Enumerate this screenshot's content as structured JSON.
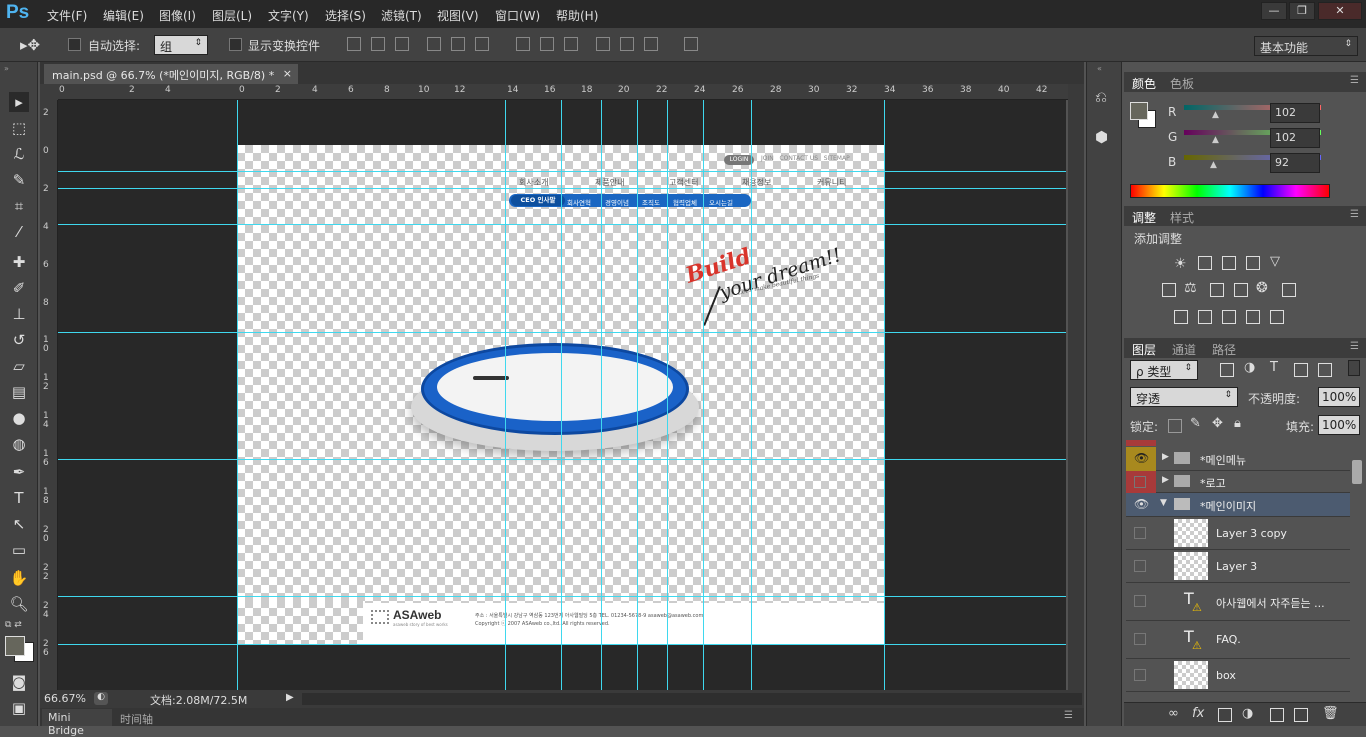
{
  "app": {
    "logo": "Ps"
  },
  "menu": [
    "文件(F)",
    "编辑(E)",
    "图像(I)",
    "图层(L)",
    "文字(Y)",
    "选择(S)",
    "滤镜(T)",
    "视图(V)",
    "窗口(W)",
    "帮助(H)"
  ],
  "window_buttons": [
    "—",
    "❐",
    "✕"
  ],
  "options": {
    "auto_select_label": "自动选择:",
    "auto_select_value": "组",
    "transform_label": "显示变换控件",
    "workspace": "基本功能"
  },
  "document": {
    "tab_title": "main.psd @ 66.7% (*메인이미지, RGB/8) *",
    "close": "×"
  },
  "ruler": {
    "h": [
      "0",
      "2",
      "4",
      "0",
      "2",
      "4",
      "6",
      "8",
      "10",
      "12",
      "14",
      "16",
      "18",
      "20",
      "22",
      "24",
      "26",
      "28",
      "30",
      "32",
      "34",
      "36",
      "38",
      "40",
      "42"
    ],
    "v": [
      "2",
      "0",
      "2",
      "4",
      "6",
      "8",
      "1 0",
      "1 2",
      "1 4",
      "1 6",
      "1 8",
      "2 0",
      "2 2",
      "2 4",
      "2 6"
    ]
  },
  "site": {
    "login": "LOGIN",
    "toplinks": "JOIN   CONTACT US   SITEMAP",
    "nav": [
      "회사소개",
      "제품안내",
      "고객센터",
      "채용정보",
      "커뮤니티"
    ],
    "subnav": [
      "CEO 인사말",
      "회사연혁",
      "경영이념",
      "조직도",
      "협력업체",
      "오시는길"
    ],
    "headline1": "Build",
    "headline2": "your dream!!",
    "tagline": "Let's make beautiful things",
    "footer_logo": "ASAweb",
    "footer_logo_sub": "asaweb story of best works",
    "footer_line1": "주소 : 서울특별시 강남구 역삼동 123번지 아사웹빌딩 5층 TEL. 01234-5678-9 asaweb@asaweb.com",
    "footer_line2": "Copyright ⓒ 2007 ASAweb co.,ltd. All rights reserved."
  },
  "status": {
    "zoom": "66.67%",
    "docsize": "文档:2.08M/72.5M"
  },
  "bottom_tabs": [
    "Mini Bridge",
    "时间轴"
  ],
  "color_panel": {
    "tabs": [
      "颜色",
      "色板"
    ],
    "r_label": "R",
    "g_label": "G",
    "b_label": "B",
    "r": "102",
    "g": "102",
    "b": "92"
  },
  "adjust_panel": {
    "tabs": [
      "调整",
      "样式"
    ],
    "title": "添加调整"
  },
  "layers_panel": {
    "tabs": [
      "图层",
      "通道",
      "路径"
    ],
    "filter": "ρ 类型",
    "blend": "穿透",
    "opacity_label": "不透明度:",
    "opacity": "100%",
    "lock_label": "锁定:",
    "fill_label": "填充:",
    "fill": "100%",
    "layers": [
      {
        "name": "*메인메뉴",
        "type": "group",
        "color": "#a8891e",
        "visible": true
      },
      {
        "name": "*로고",
        "type": "group",
        "color": "#a83a3a",
        "visible": false
      },
      {
        "name": "*메인이미지",
        "type": "group-open",
        "color": "#4c5b70",
        "visible": true
      },
      {
        "name": "Layer 3 copy",
        "type": "layer",
        "visible": false
      },
      {
        "name": "Layer 3",
        "type": "layer",
        "visible": false
      },
      {
        "name": "아사웹에서 자주듣는 ...",
        "type": "smart",
        "visible": false
      },
      {
        "name": "FAQ.",
        "type": "smart",
        "visible": false
      },
      {
        "name": "box",
        "type": "layer",
        "visible": false
      }
    ]
  },
  "colors": {
    "accent": "#4fb4f0",
    "guide": "#3fd8ee",
    "brand_blue": "#1a66c2",
    "headline_red": "#d9342b"
  }
}
